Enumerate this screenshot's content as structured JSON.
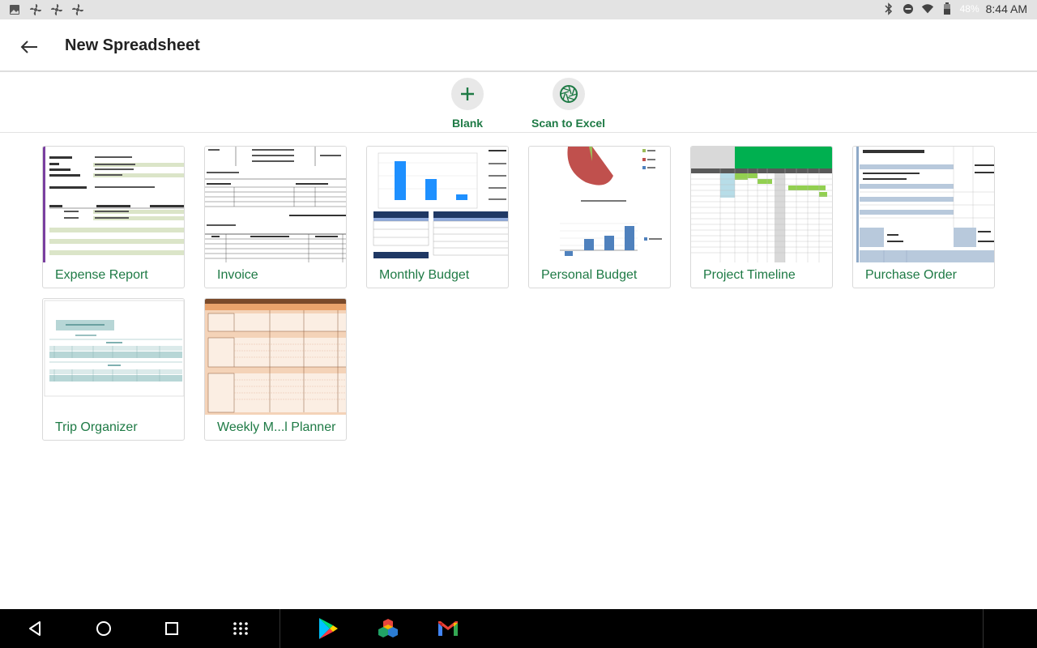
{
  "status_bar": {
    "left_icons": [
      "gallery-icon",
      "fan-icon",
      "fan-icon",
      "fan-icon"
    ],
    "right_icons": [
      "bluetooth-icon",
      "dnd-icon",
      "wifi-icon",
      "battery-icon"
    ],
    "battery": "48%",
    "time": "8:44 AM"
  },
  "appbar": {
    "title": "New Spreadsheet"
  },
  "actions": [
    {
      "label": "Blank",
      "icon": "plus-icon"
    },
    {
      "label": "Scan to Excel",
      "icon": "camera-shutter-icon"
    }
  ],
  "templates": [
    {
      "label": "Expense Report"
    },
    {
      "label": "Invoice"
    },
    {
      "label": "Monthly Budget"
    },
    {
      "label": "Personal Budget"
    },
    {
      "label": "Project Timeline"
    },
    {
      "label": "Purchase Order"
    },
    {
      "label": "Trip Organizer"
    },
    {
      "label": "Weekly M...l Planner"
    }
  ],
  "navbar": {
    "buttons": [
      "back-icon",
      "home-icon",
      "recents-icon",
      "app-drawer-icon",
      "play-store-icon",
      "office-app-icon",
      "gmail-icon"
    ]
  },
  "colors": {
    "accent_green": "#1e7a45",
    "status_bar_bg": "#e3e3e3",
    "nav_bar_bg": "#000000"
  }
}
